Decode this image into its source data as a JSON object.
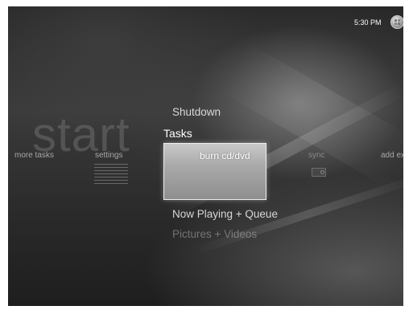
{
  "header": {
    "time": "5:30 PM",
    "logo_icon": "windows-logo-icon"
  },
  "watermark": "start",
  "vertical_menu": {
    "above": [
      "Shutdown"
    ],
    "current_section": "Tasks",
    "below": [
      "Now Playing + Queue",
      "Pictures + Videos"
    ]
  },
  "tasks_strip": {
    "items": [
      "more tasks",
      "settings",
      "burn cd/dvd",
      "sync",
      "add ext"
    ],
    "selected": "burn cd/dvd"
  },
  "colors": {
    "background": "#2e2e2e",
    "tile_highlight": "#b0b0b0",
    "text": "#ffffff"
  }
}
